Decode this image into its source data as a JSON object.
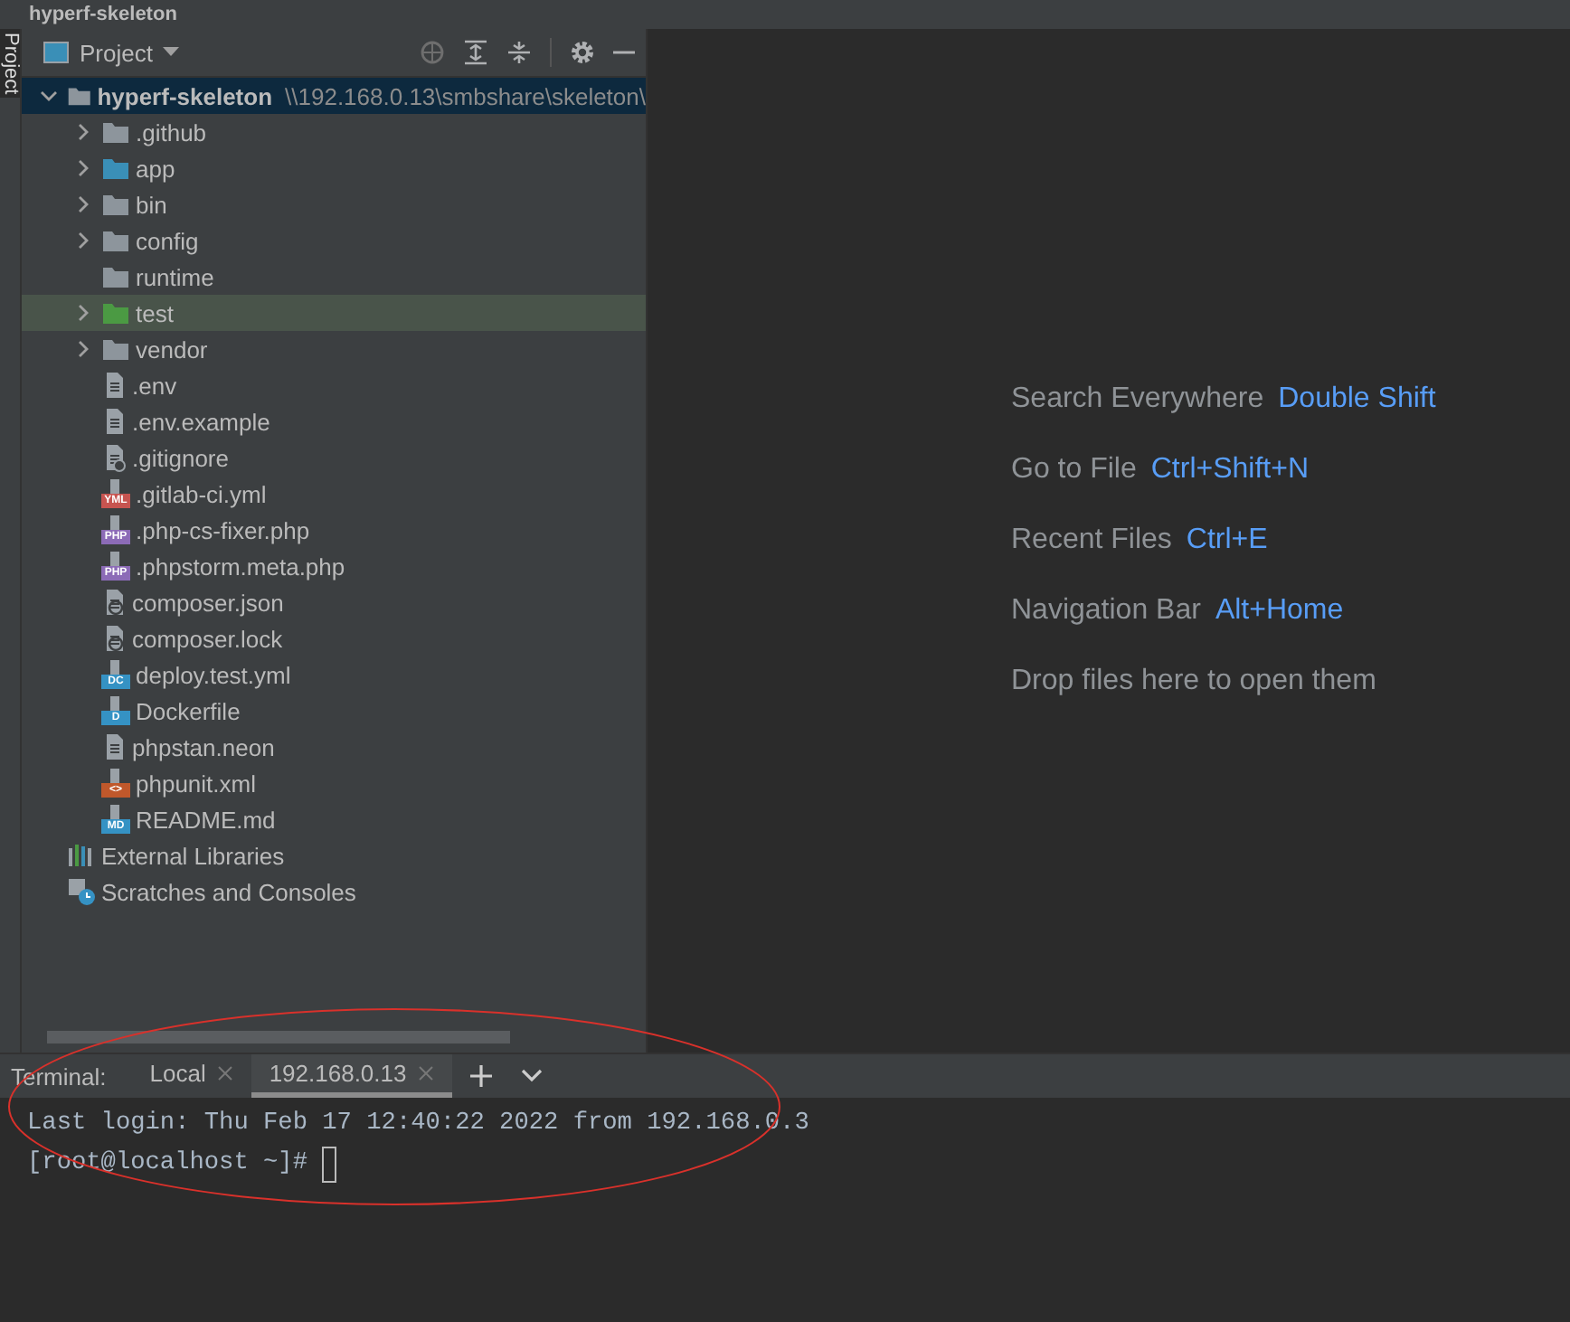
{
  "window": {
    "title": "hyperf-skeleton"
  },
  "side_tab": {
    "label": "Project",
    "selected": true
  },
  "project_panel": {
    "view": "Project"
  },
  "tree": [
    {
      "label": "hyperf-skeleton",
      "path": "\\\\192.168.0.13\\smbshare\\skeleton\\",
      "kind": "folder",
      "expanded": true,
      "selected": true,
      "children": [
        {
          "label": ".github",
          "kind": "folder",
          "expanded": false,
          "selected": false
        },
        {
          "label": "app",
          "kind": "source-folder",
          "expanded": false,
          "selected": false
        },
        {
          "label": "bin",
          "kind": "folder",
          "expanded": false,
          "selected": false
        },
        {
          "label": "config",
          "kind": "folder",
          "expanded": false,
          "selected": false
        },
        {
          "label": "runtime",
          "kind": "folder",
          "selected": false
        },
        {
          "label": "test",
          "kind": "test-folder",
          "expanded": false,
          "selected": false
        },
        {
          "label": "vendor",
          "kind": "folder",
          "expanded": false,
          "selected": false
        },
        {
          "label": ".env",
          "kind": "text-file",
          "selected": false
        },
        {
          "label": ".env.example",
          "kind": "text-file",
          "selected": false
        },
        {
          "label": ".gitignore",
          "kind": "ignore-file",
          "selected": false
        },
        {
          "label": ".gitlab-ci.yml",
          "kind": "yml-file",
          "tag": "YML",
          "selected": false
        },
        {
          "label": ".php-cs-fixer.php",
          "kind": "php-file",
          "tag": "PHP",
          "selected": false
        },
        {
          "label": ".phpstorm.meta.php",
          "kind": "php-file",
          "tag": "PHP",
          "selected": false
        },
        {
          "label": "composer.json",
          "kind": "composer-file",
          "selected": false
        },
        {
          "label": "composer.lock",
          "kind": "composer-file",
          "selected": false
        },
        {
          "label": "deploy.test.yml",
          "kind": "compose-file",
          "tag": "DC",
          "selected": false
        },
        {
          "label": "Dockerfile",
          "kind": "docker-file",
          "tag": "D",
          "selected": false
        },
        {
          "label": "phpstan.neon",
          "kind": "text-file",
          "selected": false
        },
        {
          "label": "phpunit.xml",
          "kind": "xml-file",
          "tag": "<>",
          "selected": false
        },
        {
          "label": "README.md",
          "kind": "md-file",
          "tag": "MD",
          "selected": false
        }
      ]
    },
    {
      "label": "External Libraries",
      "kind": "libraries",
      "selected": false
    },
    {
      "label": "Scratches and Consoles",
      "kind": "scratches",
      "selected": false
    }
  ],
  "editor_hints": [
    {
      "label": "Search Everywhere",
      "shortcut": "Double Shift"
    },
    {
      "label": "Go to File",
      "shortcut": "Ctrl+Shift+N"
    },
    {
      "label": "Recent Files",
      "shortcut": "Ctrl+E"
    },
    {
      "label": "Navigation Bar",
      "shortcut": "Alt+Home"
    },
    {
      "label": "Drop files here to open them"
    }
  ],
  "terminal": {
    "title": "Terminal:",
    "tabs": [
      {
        "label": "Local",
        "selected": false
      },
      {
        "label": "192.168.0.13",
        "selected": true
      }
    ],
    "lines": [
      "Last login: Thu Feb 17 12:40:22 2022 from 192.168.0.3",
      "[root@localhost ~]#"
    ]
  },
  "annotation": {
    "kind": "ellipse",
    "color": "#d9312b"
  }
}
